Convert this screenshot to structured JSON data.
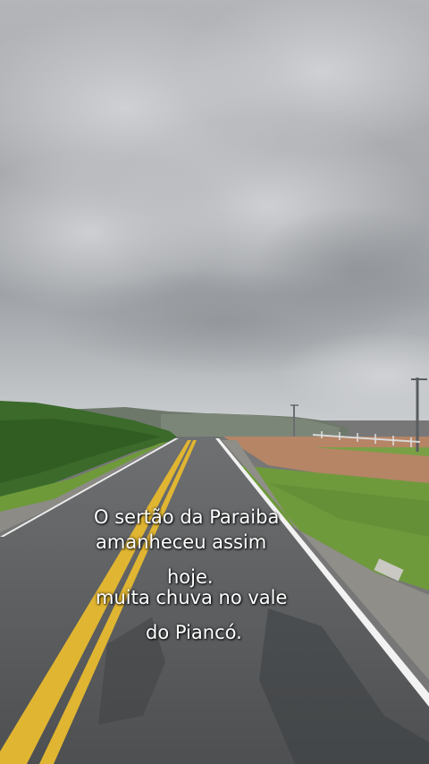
{
  "caption": {
    "lines": [
      "O sertão da Paraiba",
      "amanheceu assim",
      "hoje.",
      "muita chuva no vale",
      "do Piancó."
    ]
  },
  "colors": {
    "sky_top": "#b9bbbf",
    "sky_mid": "#a4a6aa",
    "sky_horizon": "#c6c9cc",
    "road": "#5c5e60",
    "center_line": "#e0b531",
    "edge_line": "#f0f0f0",
    "vegetation": "#3a6b2a",
    "grass": "#6f9a3c",
    "dirt": "#b58566",
    "hills": "#6f7a6a"
  }
}
